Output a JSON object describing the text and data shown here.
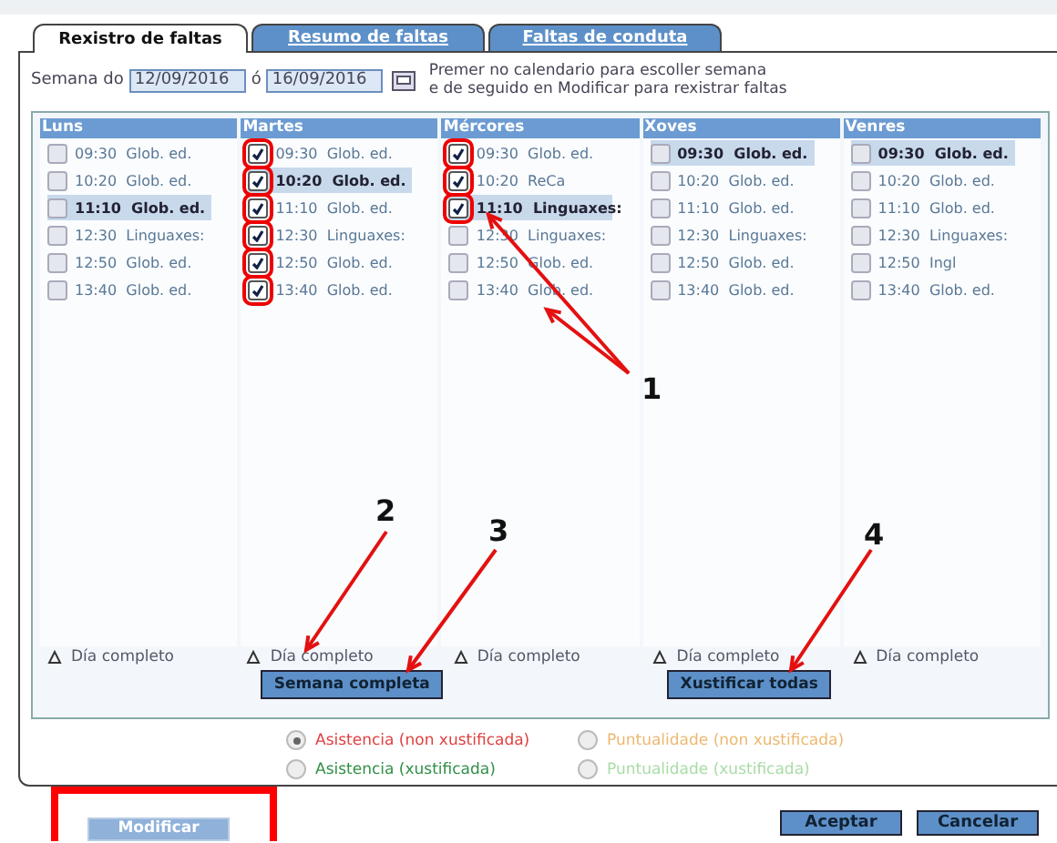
{
  "tabs": [
    {
      "label": "Rexistro de faltas",
      "selected": true
    },
    {
      "label": "Resumo de faltas",
      "selected": false
    },
    {
      "label": "Faltas de conduta",
      "selected": false
    }
  ],
  "week": {
    "label": "Semana do",
    "from": "12/09/2016",
    "separator": "ó",
    "to": "16/09/2016",
    "hint": "Premer no calendario para escoller semana\ne de seguido en Modificar para rexistrar faltas"
  },
  "days": [
    {
      "name": "Luns",
      "full_day": "Día completo",
      "slots": [
        {
          "time": "09:30",
          "subject": "Glob. ed.",
          "checked": false,
          "selected": false,
          "marked": false
        },
        {
          "time": "10:20",
          "subject": "Glob. ed.",
          "checked": false,
          "selected": false,
          "marked": false
        },
        {
          "time": "11:10",
          "subject": "Glob. ed.",
          "checked": false,
          "selected": true,
          "marked": false
        },
        {
          "time": "12:30",
          "subject": "Linguaxes:",
          "checked": false,
          "selected": false,
          "marked": false
        },
        {
          "time": "12:50",
          "subject": "Glob. ed.",
          "checked": false,
          "selected": false,
          "marked": false
        },
        {
          "time": "13:40",
          "subject": "Glob. ed.",
          "checked": false,
          "selected": false,
          "marked": false
        }
      ]
    },
    {
      "name": "Martes",
      "full_day": "Día completo",
      "button": "Semana completa",
      "slots": [
        {
          "time": "09:30",
          "subject": "Glob. ed.",
          "checked": true,
          "selected": false,
          "marked": true
        },
        {
          "time": "10:20",
          "subject": "Glob. ed.",
          "checked": true,
          "selected": true,
          "marked": true
        },
        {
          "time": "11:10",
          "subject": "Glob. ed.",
          "checked": true,
          "selected": false,
          "marked": true
        },
        {
          "time": "12:30",
          "subject": "Linguaxes:",
          "checked": true,
          "selected": false,
          "marked": true
        },
        {
          "time": "12:50",
          "subject": "Glob. ed.",
          "checked": true,
          "selected": false,
          "marked": true
        },
        {
          "time": "13:40",
          "subject": "Glob. ed.",
          "checked": true,
          "selected": false,
          "marked": true
        }
      ]
    },
    {
      "name": "Mércores",
      "full_day": "Día completo",
      "slots": [
        {
          "time": "09:30",
          "subject": "Glob. ed.",
          "checked": true,
          "selected": false,
          "marked": true
        },
        {
          "time": "10:20",
          "subject": "ReCa",
          "checked": true,
          "selected": false,
          "marked": true
        },
        {
          "time": "11:10",
          "subject": "Linguaxes:",
          "checked": true,
          "selected": true,
          "marked": true
        },
        {
          "time": "12:30",
          "subject": "Linguaxes:",
          "checked": false,
          "selected": false,
          "marked": false
        },
        {
          "time": "12:50",
          "subject": "Glob. ed.",
          "checked": false,
          "selected": false,
          "marked": false
        },
        {
          "time": "13:40",
          "subject": "Glob. ed.",
          "checked": false,
          "selected": false,
          "marked": false
        }
      ]
    },
    {
      "name": "Xoves",
      "full_day": "Día completo",
      "button": "Xustificar todas",
      "slots": [
        {
          "time": "09:30",
          "subject": "Glob. ed.",
          "checked": false,
          "selected": true,
          "marked": false
        },
        {
          "time": "10:20",
          "subject": "Glob. ed.",
          "checked": false,
          "selected": false,
          "marked": false
        },
        {
          "time": "11:10",
          "subject": "Glob. ed.",
          "checked": false,
          "selected": false,
          "marked": false
        },
        {
          "time": "12:30",
          "subject": "Linguaxes:",
          "checked": false,
          "selected": false,
          "marked": false
        },
        {
          "time": "12:50",
          "subject": "Glob. ed.",
          "checked": false,
          "selected": false,
          "marked": false
        },
        {
          "time": "13:40",
          "subject": "Glob. ed.",
          "checked": false,
          "selected": false,
          "marked": false
        }
      ]
    },
    {
      "name": "Venres",
      "full_day": "Día completo",
      "slots": [
        {
          "time": "09:30",
          "subject": "Glob. ed.",
          "checked": false,
          "selected": true,
          "marked": false
        },
        {
          "time": "10:20",
          "subject": "Glob. ed.",
          "checked": false,
          "selected": false,
          "marked": false
        },
        {
          "time": "11:10",
          "subject": "Glob. ed.",
          "checked": false,
          "selected": false,
          "marked": false
        },
        {
          "time": "12:30",
          "subject": "Linguaxes:",
          "checked": false,
          "selected": false,
          "marked": false
        },
        {
          "time": "12:50",
          "subject": "Ingl",
          "checked": false,
          "selected": false,
          "marked": false
        },
        {
          "time": "13:40",
          "subject": "Glob. ed.",
          "checked": false,
          "selected": false,
          "marked": false
        }
      ]
    }
  ],
  "absence_types": [
    {
      "label": "Asistencia (non xustificada)",
      "selected": true,
      "color": "#e04040"
    },
    {
      "label": "Puntualidade (non xustificada)",
      "selected": false,
      "color": "#ecb870"
    },
    {
      "label": "Asistencia (xustificada)",
      "selected": false,
      "color": "#2f8f45"
    },
    {
      "label": "Puntualidade (xustificada)",
      "selected": false,
      "color": "#a8dca6"
    }
  ],
  "modify_button": {
    "label": "Modificar",
    "disabled": true,
    "marked": true
  },
  "buttons": [
    "Aceptar",
    "Cancelar"
  ],
  "callouts": [
    "1",
    "2",
    "3",
    "4"
  ]
}
